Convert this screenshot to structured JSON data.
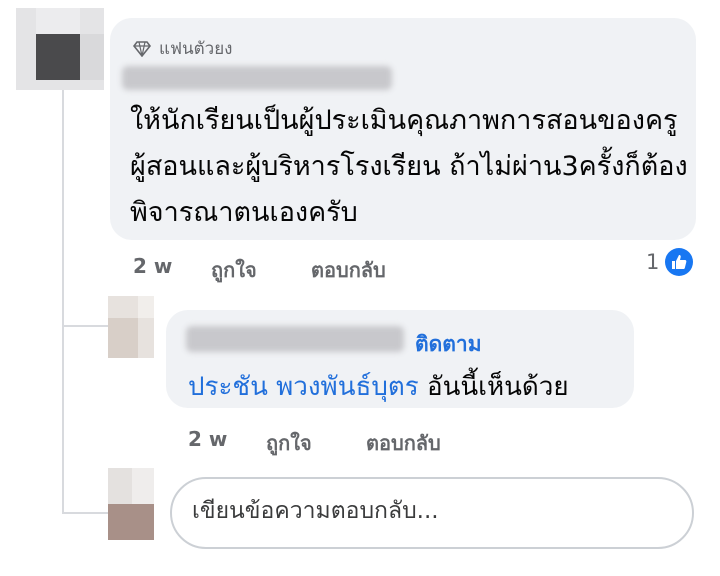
{
  "comment_main": {
    "badge_label": "แฟนตัวยง",
    "text": "ให้นักเรียนเป็นผู้ประเมินคุณภาพการสอนของครูผู้สอนและผู้บริหารโรงเรียน ถ้าไม่ผ่าน3ครั้งก็ต้องพิจารณาตนเองครับ",
    "time": "2 w",
    "like_label": "ถูกใจ",
    "reply_label": "ตอบกลับ",
    "reaction_count": "1",
    "reaction_icon": "like-icon"
  },
  "comment_reply": {
    "follow_label": "ติดตาม",
    "mention": "ประชัน พวงพันธ์บุตร",
    "text": "อันนี้เห็นด้วย",
    "time": "2 w",
    "like_label": "ถูกใจ",
    "reply_label": "ตอบกลับ"
  },
  "reply_input": {
    "placeholder": "เขียนข้อความตอบกลับ..."
  },
  "colors": {
    "bubble": "#f0f2f5",
    "link": "#216fdb",
    "meta": "#65676b",
    "like": "#1877f2"
  }
}
